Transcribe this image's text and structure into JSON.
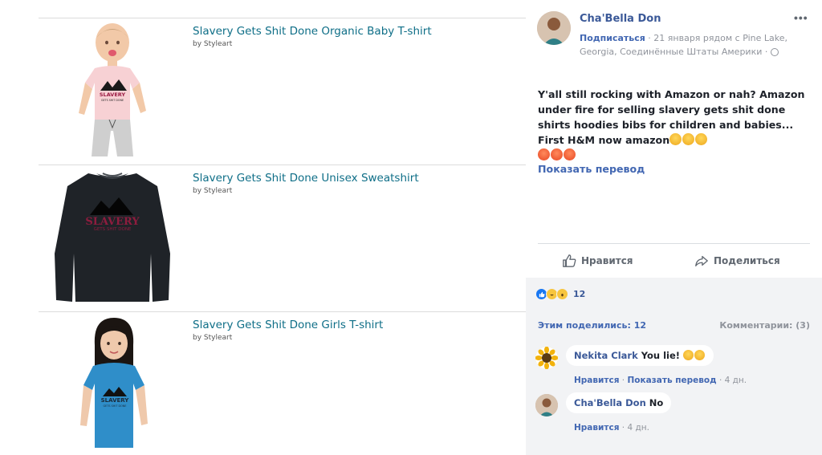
{
  "products": [
    {
      "title": "Slavery Gets Shit Done Organic Baby T-shirt",
      "by": "by Styleart",
      "print": [
        "SLAVERY",
        "GETS SHIT DONE"
      ]
    },
    {
      "title": "Slavery Gets Shit Done Unisex Sweatshirt",
      "by": "by Styleart",
      "print": [
        "SLAVERY",
        "GETS SHIT DONE"
      ]
    },
    {
      "title": "Slavery Gets Shit Done Girls T-shirt",
      "by": "by Styleart",
      "print": [
        "SLAVERY",
        "GETS SHIT DONE"
      ]
    }
  ],
  "post": {
    "author": "Cha'Bella Don",
    "more_icon": "more-horizontal-icon",
    "follow": "Подписаться",
    "meta_rest": " · 21 января рядом с Pine Lake, Georgia, Соединённые Штаты Америки · ",
    "text": "Y'all still rocking with Amazon or nah? Amazon under fire for selling slavery gets shit done shirts hoodies bibs for children and babies... First H&M now amazon",
    "emoji_line1": [
      "pensive",
      "pensive",
      "pensive"
    ],
    "emoji_line2": [
      "angry",
      "angry",
      "angry"
    ],
    "translate": "Показать перевод",
    "like_label": "Нравится",
    "share_label": "Поделиться",
    "reactions_count": "12",
    "shares": "Этим поделились: 12",
    "comments_count": "Комментарии: (3)"
  },
  "comments": [
    {
      "name": "Nekita Clark",
      "text": "You lie!",
      "emoji": [
        "worried",
        "worried"
      ],
      "like": "Нравится",
      "translate": "Показать перевод",
      "time": "4 дн."
    },
    {
      "name": "Cha'Bella Don",
      "text": "No",
      "like": "Нравится",
      "time": "4 дн."
    }
  ],
  "colors": {
    "link": "#0e6e87",
    "fb_blue": "#3b5998",
    "fb_link": "#4267b2",
    "muted": "#90949c"
  }
}
